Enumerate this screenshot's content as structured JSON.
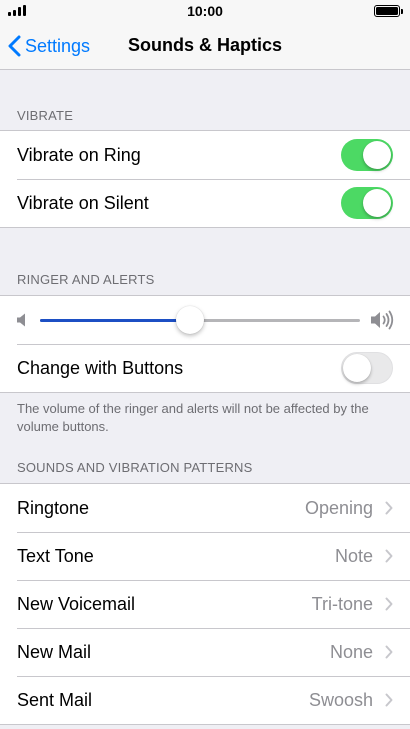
{
  "status_bar": {
    "time": "10:00"
  },
  "nav": {
    "back_label": "Settings",
    "title": "Sounds & Haptics"
  },
  "vibrate": {
    "header": "VIBRATE",
    "items": [
      {
        "label": "Vibrate on Ring",
        "on": true
      },
      {
        "label": "Vibrate on Silent",
        "on": true
      }
    ]
  },
  "ringer": {
    "header": "RINGER AND ALERTS",
    "volume_fraction": 0.47,
    "change_with_buttons_label": "Change with Buttons",
    "change_with_buttons_on": false,
    "footer": "The volume of the ringer and alerts will not be affected by the volume buttons."
  },
  "patterns": {
    "header": "SOUNDS AND VIBRATION PATTERNS",
    "items": [
      {
        "label": "Ringtone",
        "value": "Opening"
      },
      {
        "label": "Text Tone",
        "value": "Note"
      },
      {
        "label": "New Voicemail",
        "value": "Tri-tone"
      },
      {
        "label": "New Mail",
        "value": "None"
      },
      {
        "label": "Sent Mail",
        "value": "Swoosh"
      }
    ]
  },
  "colors": {
    "accent": "#007aff",
    "toggle_on": "#4cd964",
    "slider_fill": "#1c4fc4"
  }
}
